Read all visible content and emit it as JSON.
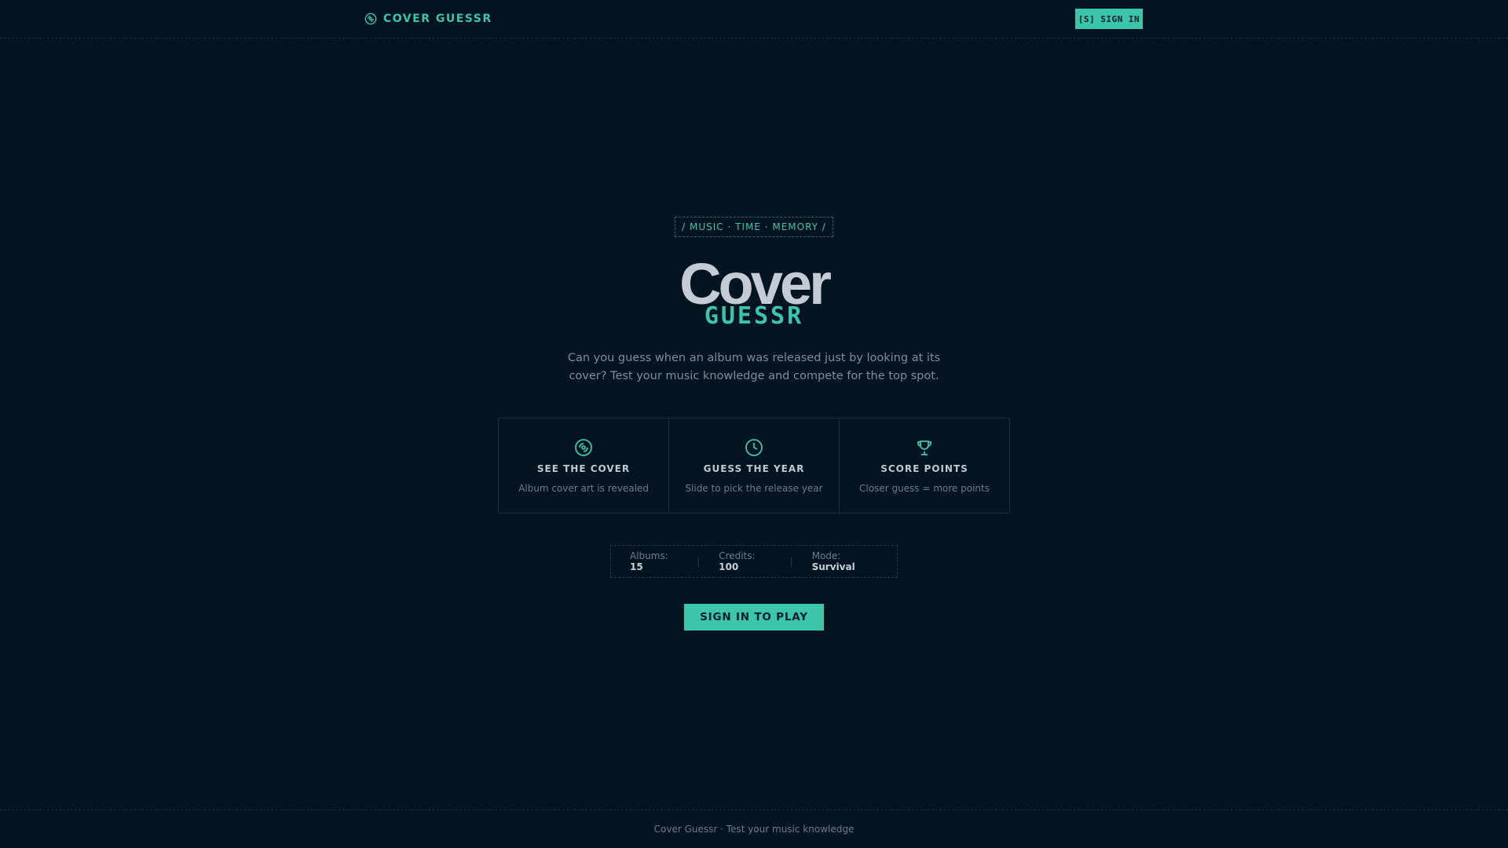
{
  "header": {
    "brand": "COVER GUESSR",
    "brand_icon": "vinyl-disc-icon",
    "signin_label": "[S] SIGN IN"
  },
  "hero": {
    "tagline": "/ MUSIC · TIME · MEMORY /",
    "title_top": "Cover",
    "title_bottom": "GUESSR",
    "intro": "Can you guess when an album was released just by looking at its cover? Test your music knowledge and compete for the top spot."
  },
  "steps": [
    {
      "icon": "vinyl-disc-icon",
      "title": "SEE THE COVER",
      "desc": "Album cover art is revealed"
    },
    {
      "icon": "clock-icon",
      "title": "GUESS THE YEAR",
      "desc": "Slide to pick the release year"
    },
    {
      "icon": "trophy-icon",
      "title": "SCORE POINTS",
      "desc": "Closer guess = more points"
    }
  ],
  "stats": {
    "albums_label": "Albums:",
    "albums_value": "15",
    "credits_label": "Credits:",
    "credits_value": "100",
    "mode_label": "Mode:",
    "mode_value": "Survival"
  },
  "play_label": "SIGN IN TO PLAY",
  "footer": {
    "text": "Cover Guessr · Test your music knowledge"
  },
  "colors": {
    "background": "#031421",
    "accent": "#3cc5a8",
    "text_muted": "#808c96"
  }
}
